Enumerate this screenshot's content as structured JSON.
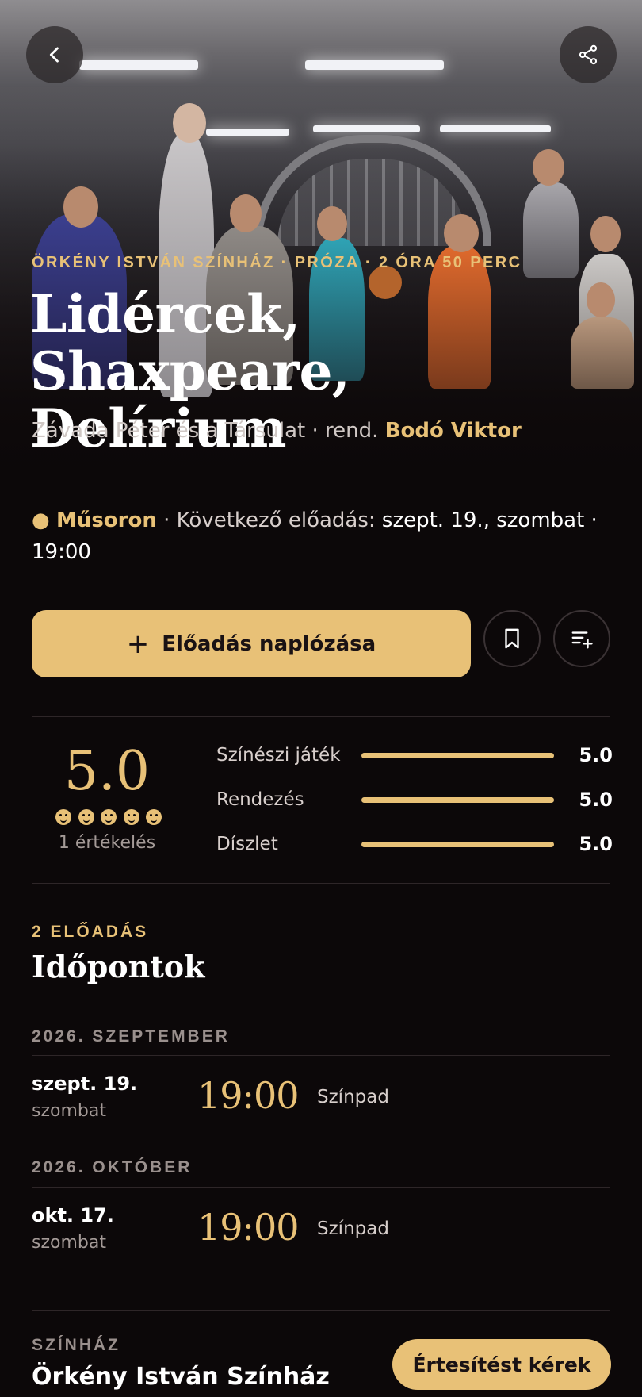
{
  "hero": {
    "meta": "ÖRKÉNY ISTVÁN SZÍNHÁZ · PRÓZA · 2 ÓRA 50 PERC",
    "title": "Lidércek, Shaxpeare, Delírium",
    "credits_prefix": "Závada Péter és a Társulat · rend. ",
    "director": "Bodó Viktor",
    "back_icon": "chevron-left-icon",
    "share_icon": "share-icon"
  },
  "status": {
    "dot": "●",
    "live": "Műsoron",
    "separator": " · Következő előadás: ",
    "next": "szept. 19., szombat · 19:00"
  },
  "actions": {
    "log_label": "Előadás naplózása",
    "log_icon": "plus-icon",
    "bookmark_icon": "bookmark-icon",
    "add_to_list_icon": "playlist-add-icon"
  },
  "rating": {
    "score": "5.0",
    "faces": 5,
    "count_label": "1 értékelés",
    "criteria": [
      {
        "label": "Színészi játék",
        "value": "5.0",
        "fraction": 1.0
      },
      {
        "label": "Rendezés",
        "value": "5.0",
        "fraction": 1.0
      },
      {
        "label": "Díszlet",
        "value": "5.0",
        "fraction": 1.0
      }
    ]
  },
  "schedule": {
    "eyebrow": "2 ELŐADÁS",
    "title": "Időpontok",
    "months": [
      {
        "label": "2026. SZEPTEMBER",
        "performances": [
          {
            "date": "szept. 19.",
            "day": "szombat",
            "time": "19:00",
            "venue": "Színpad"
          }
        ]
      },
      {
        "label": "2026. OKTÓBER",
        "performances": [
          {
            "date": "okt. 17.",
            "day": "szombat",
            "time": "19:00",
            "venue": "Színpad"
          }
        ]
      }
    ]
  },
  "footer": {
    "venue_label": "SZÍNHÁZ",
    "venue_name": "Örkény István Színház",
    "notify_label": "Értesítést kérek"
  },
  "colors": {
    "accent": "#e8c177",
    "background": "#0c0809",
    "muted_text": "#a49a97"
  }
}
